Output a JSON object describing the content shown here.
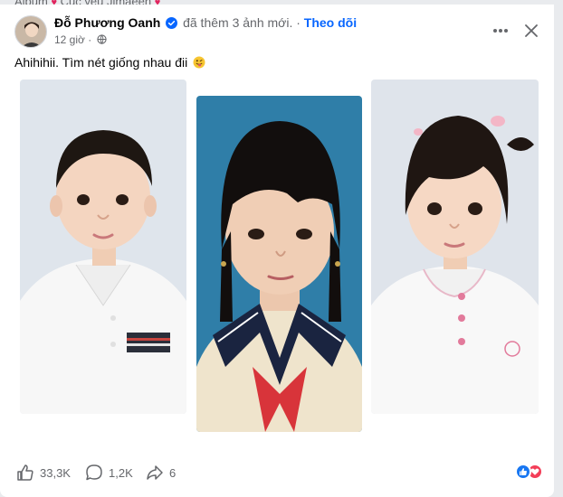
{
  "album": {
    "prefix": "Album",
    "name": "Cục yêu Jimaeeh"
  },
  "post": {
    "author": "Đỗ Phương Oanh",
    "action": "đã thêm 3 ảnh mới.",
    "separator": "·",
    "follow_label": "Theo dõi",
    "time": "12 giờ",
    "meta_separator": "·",
    "text": "Ahihihii. Tìm nét giống nhau đii",
    "photos": [
      {
        "alt": "Bé trai áo polo trắng"
      },
      {
        "alt": "Bé gái đồng phục khăn quàng đỏ"
      },
      {
        "alt": "Bé gái áo trắng kẹp tóc"
      }
    ]
  },
  "stats": {
    "likes": "33,3K",
    "comments": "1,2K",
    "shares": "6"
  },
  "icons": {
    "verified": "verified-badge-icon",
    "privacy": "globe-icon",
    "more": "more-options-icon",
    "close": "close-icon",
    "emoji": "tongue-out-emoji-icon",
    "like": "thumbs-up-icon",
    "comment": "comment-bubble-icon",
    "share": "share-arrow-icon"
  },
  "colors": {
    "accent": "#0866ff",
    "like": "#1877f2",
    "love": "#f33e58",
    "secondary_text": "#65676b"
  }
}
